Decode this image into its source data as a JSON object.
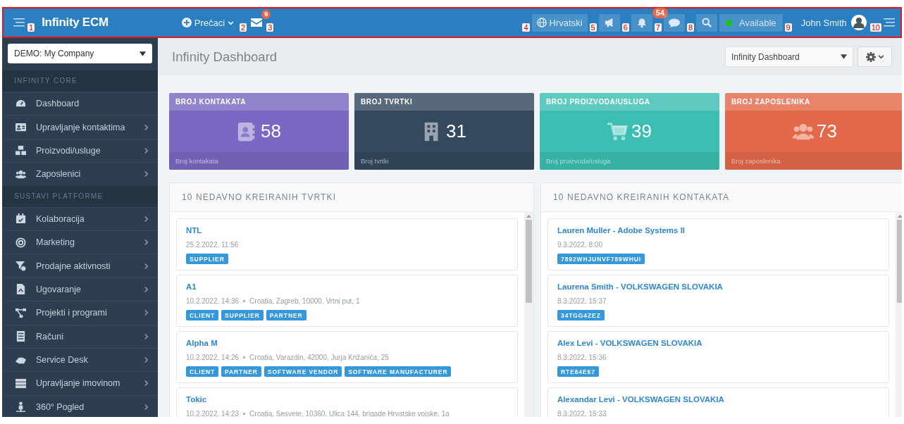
{
  "top_bar": {
    "left": [
      {
        "kind": "menu"
      },
      {
        "kind": "callout",
        "text": "1"
      },
      {
        "kind": "logo",
        "text": "Infinity ECM"
      },
      {
        "kind": "shortcuts",
        "label": "Prečaci"
      },
      {
        "kind": "callout",
        "text": "2"
      },
      {
        "kind": "messages",
        "badge": "9"
      },
      {
        "kind": "callout",
        "text": "3"
      }
    ],
    "right": [
      {
        "kind": "callout",
        "text": "4"
      },
      {
        "kind": "language",
        "label": "Hrvatski"
      },
      {
        "kind": "callout",
        "text": "5"
      },
      {
        "kind": "announcements"
      },
      {
        "kind": "callout",
        "text": "6"
      },
      {
        "kind": "notifications",
        "badge": "54"
      },
      {
        "kind": "callout",
        "text": "7"
      },
      {
        "kind": "chat"
      },
      {
        "kind": "callout",
        "text": "8"
      },
      {
        "kind": "search"
      },
      {
        "kind": "status",
        "label": "Available"
      },
      {
        "kind": "callout",
        "text": "9"
      },
      {
        "kind": "user",
        "name": "John Smith"
      },
      {
        "kind": "callout",
        "text": "10"
      },
      {
        "kind": "menu"
      }
    ]
  },
  "sidebar": {
    "company": "DEMO: My Company",
    "sections": [
      {
        "title": "INFINITY CORE",
        "items": [
          {
            "label": "Dashboard",
            "has_submenu": false
          },
          {
            "label": "Upravljanje kontaktima",
            "has_submenu": true
          },
          {
            "label": "Proizvodi/usluge",
            "has_submenu": true
          },
          {
            "label": "Zaposlenici",
            "has_submenu": true
          }
        ]
      },
      {
        "title": "SUSTAVI PLATFORME",
        "items": [
          {
            "label": "Kolaboracija",
            "has_submenu": true
          },
          {
            "label": "Marketing",
            "has_submenu": true
          },
          {
            "label": "Prodajne aktivnosti",
            "has_submenu": true
          },
          {
            "label": "Ugovaranje",
            "has_submenu": true
          },
          {
            "label": "Projekti i programi",
            "has_submenu": true
          },
          {
            "label": "Računi",
            "has_submenu": true
          },
          {
            "label": "Service Desk",
            "has_submenu": true
          },
          {
            "label": "Upravljanje imovinom",
            "has_submenu": true
          },
          {
            "label": "360° Pogled",
            "has_submenu": true
          }
        ]
      }
    ]
  },
  "header": {
    "title": "Infinity Dashboard",
    "dashboard_select": "Infinity Dashboard"
  },
  "stats": [
    {
      "title": "BROJ KONTAKATA",
      "value": "58",
      "footer": "Broj kontakata",
      "color": "#7b68c2"
    },
    {
      "title": "BROJ TVRTKI",
      "value": "31",
      "footer": "Broj tvrtki",
      "color": "#34495e"
    },
    {
      "title": "BROJ PROIZVODA/USLUGA",
      "value": "39",
      "footer": "Broj proizvoda/usluga",
      "color": "#3cbfb2"
    },
    {
      "title": "BROJ ZAPOSLENIKA",
      "value": "73",
      "footer": "Broj zaposlenika",
      "color": "#e4694a"
    }
  ],
  "panels": [
    {
      "title": "10 NEDAVNO KREIRANIH TVRTKI",
      "items": [
        {
          "name": "NTL",
          "date": "25.2.2022. 11:56",
          "tags": [
            "SUPPLIER"
          ]
        },
        {
          "name": "A1",
          "date": "10.2.2022. 14:36",
          "address": "Croatia, Zagreb, 10000, Vrtni put, 1",
          "tags": [
            "CLIENT",
            "SUPPLIER",
            "PARTNER"
          ]
        },
        {
          "name": "Alpha M",
          "date": "10.2.2022. 14:26",
          "address": "Croatia, Varazdin, 42000, Jurja Križanića, 25",
          "tags": [
            "CLIENT",
            "PARTNER",
            "SOFTWARE VENDOR",
            "SOFTWARE MANUFACTURER"
          ]
        },
        {
          "name": "Tokic",
          "date": "10.2.2022. 14:23",
          "address": "Croatia, Sesvete, 10360, Ulica 144. brigade Hrvatske vojske, 1a"
        }
      ]
    },
    {
      "title": "10 NEDAVNO KREIRANIH KONTAKATA",
      "items": [
        {
          "name": "Lauren Muller - Adobe Systems II",
          "date": "9.3.2022. 8:00",
          "tags": [
            "7892WHJUNVF789WHUI"
          ]
        },
        {
          "name": "Laurena Smith - VOLKSWAGEN SLOVAKIA",
          "date": "8.3.2022. 15:37",
          "tags": [
            "34TGG4ZEZ"
          ]
        },
        {
          "name": "Alex Levi - VOLKSWAGEN SLOVAKIA",
          "date": "8.3.2022. 15:36",
          "tags": [
            "RTE64E67"
          ]
        },
        {
          "name": "Alexandar Levi - VOLKSWAGEN SLOVAKIA",
          "date": "8.3.2022. 15:33"
        }
      ]
    }
  ]
}
